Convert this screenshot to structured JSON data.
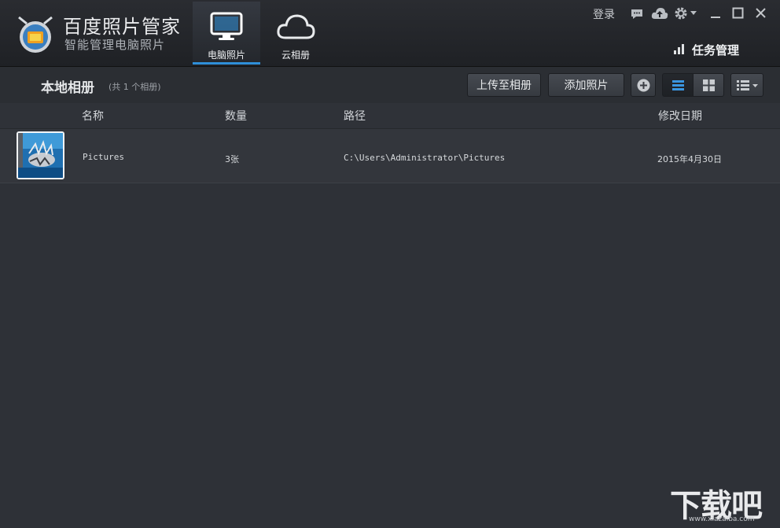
{
  "app": {
    "title": "百度照片管家",
    "subtitle": "智能管理电脑照片"
  },
  "nav_tabs": [
    {
      "label": "电脑照片",
      "icon": "monitor-icon",
      "active": true
    },
    {
      "label": "云相册",
      "icon": "cloud-icon",
      "active": false
    }
  ],
  "window_controls": {
    "login_label": "登录",
    "icons": [
      "message-icon",
      "cloud-upload-icon",
      "gear-icon",
      "chevron-down-icon",
      "minimize-icon",
      "maximize-icon",
      "close-icon"
    ]
  },
  "task_manager": {
    "label": "任务管理",
    "icon": "signal-bars-icon"
  },
  "toolbar": {
    "section_title": "本地相册",
    "section_count": "(共 1 个相册)",
    "upload_label": "上传至相册",
    "add_photo_label": "添加照片",
    "view_icons": [
      "plus-circle-icon",
      "list-view-icon",
      "grid-view-icon",
      "menu-dropdown-icon"
    ]
  },
  "table": {
    "columns": [
      "名称",
      "数量",
      "路径",
      "修改日期"
    ],
    "rows": [
      {
        "name": "Pictures",
        "count": "3张",
        "path": "C:\\Users\\Administrator\\Pictures",
        "date": "2015年4月30日"
      }
    ]
  },
  "colors": {
    "accent": "#2f8fd8",
    "background": "#2e3137",
    "titlebar": "#23252a"
  },
  "watermark": {
    "text": "下载吧",
    "url_text": "www.xiazaiba.com"
  }
}
